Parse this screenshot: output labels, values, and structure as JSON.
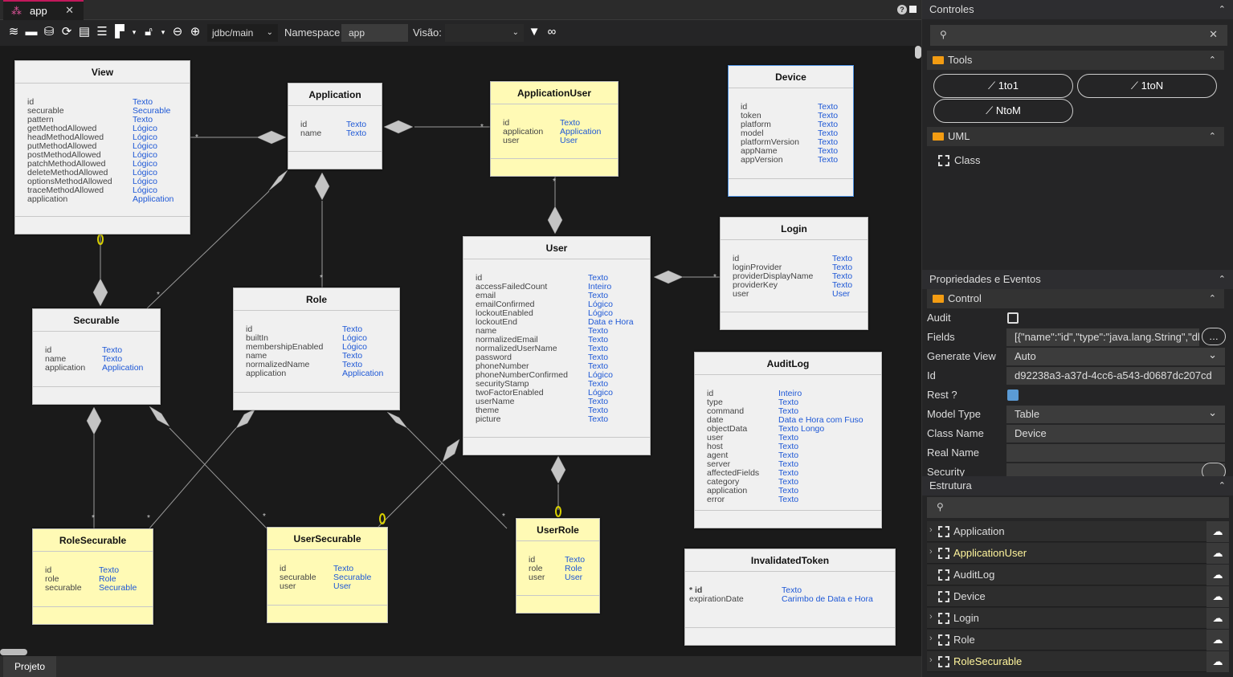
{
  "tab": {
    "title": "app",
    "close": "✕"
  },
  "toolbar": {
    "connection": "jdbc/main",
    "namespace_label": "Namespace",
    "namespace_value": "app",
    "view_label": "Visão:",
    "view_value": ""
  },
  "status": {
    "project": "Projeto"
  },
  "entities": [
    {
      "id": "View",
      "title": "View",
      "color": "white",
      "fields": [
        [
          "id",
          "Texto"
        ],
        [
          "securable",
          "Securable"
        ],
        [
          "pattern",
          "Texto"
        ],
        [
          "getMethodAllowed",
          "Lógico"
        ],
        [
          "headMethodAllowed",
          "Lógico"
        ],
        [
          "putMethodAllowed",
          "Lógico"
        ],
        [
          "postMethodAllowed",
          "Lógico"
        ],
        [
          "patchMethodAllowed",
          "Lógico"
        ],
        [
          "deleteMethodAllowed",
          "Lógico"
        ],
        [
          "optionsMethodAllowed",
          "Lógico"
        ],
        [
          "traceMethodAllowed",
          "Lógico"
        ],
        [
          "application",
          "Application"
        ]
      ]
    },
    {
      "id": "Application",
      "title": "Application",
      "color": "white",
      "fields": [
        [
          "id",
          "Texto"
        ],
        [
          "name",
          "Texto"
        ]
      ]
    },
    {
      "id": "ApplicationUser",
      "title": "ApplicationUser",
      "color": "yellow",
      "fields": [
        [
          "id",
          "Texto"
        ],
        [
          "application",
          "Application"
        ],
        [
          "user",
          "User"
        ]
      ]
    },
    {
      "id": "Device",
      "title": "Device",
      "color": "white",
      "selected": true,
      "fields": [
        [
          "id",
          "Texto"
        ],
        [
          "token",
          "Texto"
        ],
        [
          "platform",
          "Texto"
        ],
        [
          "model",
          "Texto"
        ],
        [
          "platformVersion",
          "Texto"
        ],
        [
          "appName",
          "Texto"
        ],
        [
          "appVersion",
          "Texto"
        ]
      ]
    },
    {
      "id": "Login",
      "title": "Login",
      "color": "white",
      "fields": [
        [
          "id",
          "Texto"
        ],
        [
          "loginProvider",
          "Texto"
        ],
        [
          "providerDisplayName",
          "Texto"
        ],
        [
          "providerKey",
          "Texto"
        ],
        [
          "user",
          "User"
        ]
      ]
    },
    {
      "id": "User",
      "title": "User",
      "color": "white",
      "fields": [
        [
          "id",
          "Texto"
        ],
        [
          "accessFailedCount",
          "Inteiro"
        ],
        [
          "email",
          "Texto"
        ],
        [
          "emailConfirmed",
          "Lógico"
        ],
        [
          "lockoutEnabled",
          "Lógico"
        ],
        [
          "lockoutEnd",
          "Data e Hora"
        ],
        [
          "name",
          "Texto"
        ],
        [
          "normalizedEmail",
          "Texto"
        ],
        [
          "normalizedUserName",
          "Texto"
        ],
        [
          "password",
          "Texto"
        ],
        [
          "phoneNumber",
          "Texto"
        ],
        [
          "phoneNumberConfirmed",
          "Lógico"
        ],
        [
          "securityStamp",
          "Texto"
        ],
        [
          "twoFactorEnabled",
          "Lógico"
        ],
        [
          "userName",
          "Texto"
        ],
        [
          "theme",
          "Texto"
        ],
        [
          "picture",
          "Texto"
        ]
      ]
    },
    {
      "id": "Role",
      "title": "Role",
      "color": "white",
      "fields": [
        [
          "id",
          "Texto"
        ],
        [
          "builtIn",
          "Lógico"
        ],
        [
          "membershipEnabled",
          "Lógico"
        ],
        [
          "name",
          "Texto"
        ],
        [
          "normalizedName",
          "Texto"
        ],
        [
          "application",
          "Application"
        ]
      ]
    },
    {
      "id": "Securable",
      "title": "Securable",
      "color": "white",
      "fields": [
        [
          "id",
          "Texto"
        ],
        [
          "name",
          "Texto"
        ],
        [
          "application",
          "Application"
        ]
      ]
    },
    {
      "id": "AuditLog",
      "title": "AuditLog",
      "color": "white",
      "fields": [
        [
          "id",
          "Inteiro"
        ],
        [
          "type",
          "Texto"
        ],
        [
          "command",
          "Texto"
        ],
        [
          "date",
          "Data e Hora com Fuso"
        ],
        [
          "objectData",
          "Texto Longo"
        ],
        [
          "user",
          "Texto"
        ],
        [
          "host",
          "Texto"
        ],
        [
          "agent",
          "Texto"
        ],
        [
          "server",
          "Texto"
        ],
        [
          "affectedFields",
          "Texto"
        ],
        [
          "category",
          "Texto"
        ],
        [
          "application",
          "Texto"
        ],
        [
          "error",
          "Texto"
        ]
      ]
    },
    {
      "id": "RoleSecurable",
      "title": "RoleSecurable",
      "color": "yellow",
      "fields": [
        [
          "id",
          "Texto"
        ],
        [
          "role",
          "Role"
        ],
        [
          "securable",
          "Securable"
        ]
      ]
    },
    {
      "id": "UserSecurable",
      "title": "UserSecurable",
      "color": "yellow",
      "fields": [
        [
          "id",
          "Texto"
        ],
        [
          "securable",
          "Securable"
        ],
        [
          "user",
          "User"
        ]
      ]
    },
    {
      "id": "UserRole",
      "title": "UserRole",
      "color": "yellow",
      "fields": [
        [
          "id",
          "Texto"
        ],
        [
          "role",
          "Role"
        ],
        [
          "user",
          "User"
        ]
      ]
    },
    {
      "id": "InvalidatedToken",
      "title": "InvalidatedToken",
      "color": "white",
      "fields": [
        [
          "* id",
          "Texto"
        ],
        [
          "expirationDate",
          "Carimbo de Data e Hora"
        ]
      ]
    }
  ],
  "controls": {
    "header": "Controles",
    "search_placeholder": "",
    "tools_label": "Tools",
    "tools": [
      "1to1",
      "1toN",
      "NtoM"
    ],
    "uml_label": "UML",
    "uml_items": [
      "Class"
    ]
  },
  "properties": {
    "header": "Propriedades e Eventos",
    "group": "Control",
    "rows": [
      {
        "label": "Audit",
        "type": "checkbox",
        "checked": false
      },
      {
        "label": "Fields",
        "type": "text",
        "value": "[{\"name\":\"id\",\"type\":\"java.lang.String\",\"dbl"
      },
      {
        "label": "Generate View",
        "type": "select",
        "value": "Auto"
      },
      {
        "label": "Id",
        "type": "text",
        "value": "d92238a3-a37d-4cc6-a543-d0687dc207cd"
      },
      {
        "label": "Rest ?",
        "type": "checkbox",
        "checked": true
      },
      {
        "label": "Model Type",
        "type": "select",
        "value": "Table"
      },
      {
        "label": "Class Name",
        "type": "text",
        "value": "Device"
      },
      {
        "label": "Real Name",
        "type": "text",
        "value": ""
      },
      {
        "label": "Security",
        "type": "text",
        "value": ""
      }
    ]
  },
  "structure": {
    "header": "Estrutura",
    "items": [
      {
        "name": "Application",
        "expandable": true,
        "yellow": false
      },
      {
        "name": "ApplicationUser",
        "expandable": true,
        "yellow": true
      },
      {
        "name": "AuditLog",
        "expandable": false,
        "yellow": false
      },
      {
        "name": "Device",
        "expandable": false,
        "yellow": false
      },
      {
        "name": "Login",
        "expandable": true,
        "yellow": false
      },
      {
        "name": "Role",
        "expandable": true,
        "yellow": false
      },
      {
        "name": "RoleSecurable",
        "expandable": true,
        "yellow": true
      }
    ]
  }
}
